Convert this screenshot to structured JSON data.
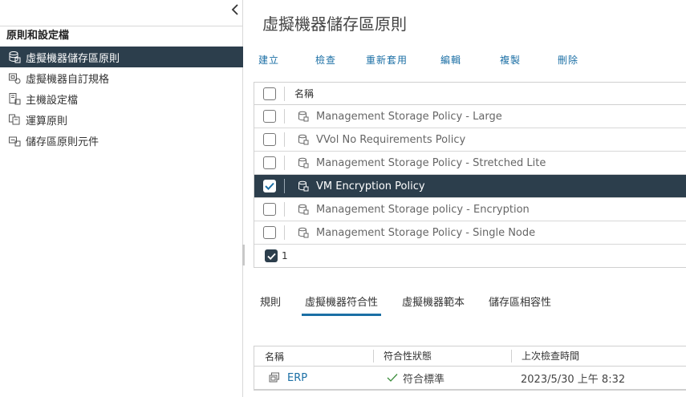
{
  "sidebar": {
    "header": "原則和設定檔",
    "items": [
      {
        "label": "虛擬機器儲存區原則",
        "icon": "storage-policy-icon",
        "active": true
      },
      {
        "label": "虛擬機器自訂規格",
        "icon": "vm-customization-icon",
        "active": false
      },
      {
        "label": "主機設定檔",
        "icon": "host-profile-icon",
        "active": false
      },
      {
        "label": "運算原則",
        "icon": "compute-policy-icon",
        "active": false
      },
      {
        "label": "儲存區原則元件",
        "icon": "storage-component-icon",
        "active": false
      }
    ]
  },
  "main": {
    "title": "虛擬機器儲存區原則",
    "toolbar": [
      "建立",
      "檢查",
      "重新套用",
      "編輯",
      "複製",
      "刪除"
    ],
    "grid": {
      "column_name": "名稱",
      "rows": [
        {
          "name": "Management Storage Policy - Large",
          "selected": false
        },
        {
          "name": "VVol No Requirements Policy",
          "selected": false
        },
        {
          "name": "Management Storage Policy - Stretched Lite",
          "selected": false
        },
        {
          "name": "VM Encryption Policy",
          "selected": true
        },
        {
          "name": "Management Storage policy - Encryption",
          "selected": false
        },
        {
          "name": "Management Storage Policy - Single Node",
          "selected": false
        }
      ],
      "selected_count": "1"
    },
    "tabs": [
      {
        "label": "規則",
        "active": false
      },
      {
        "label": "虛擬機器符合性",
        "active": true
      },
      {
        "label": "虛擬機器範本",
        "active": false
      },
      {
        "label": "儲存區相容性",
        "active": false
      }
    ],
    "compliance": {
      "columns": [
        "名稱",
        "符合性狀態",
        "上次檢查時間"
      ],
      "rows": [
        {
          "name": "ERP",
          "status": "符合標準",
          "last_checked": "2023/5/30 上午 8:32"
        }
      ]
    }
  },
  "colors": {
    "accent": "#1b6fa5",
    "selected_bg": "#2c3e4c",
    "compliant_green": "#3c8d3c"
  }
}
